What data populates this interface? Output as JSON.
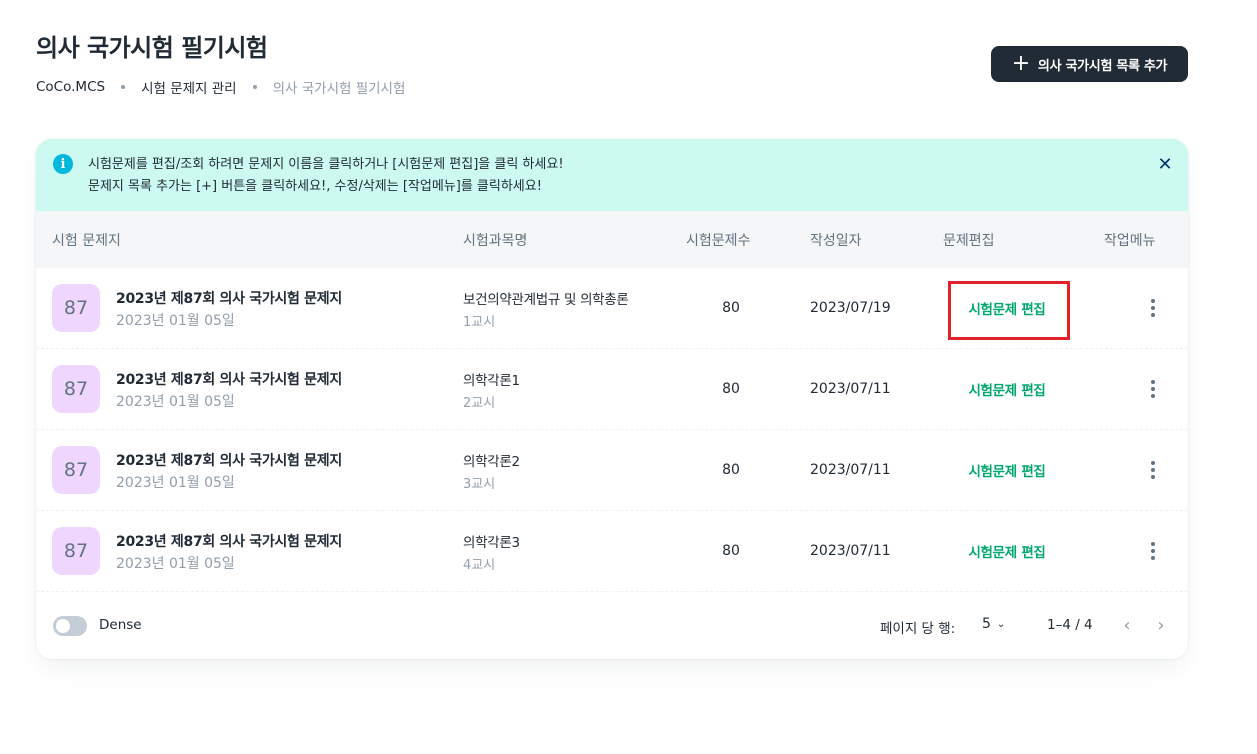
{
  "header": {
    "title": "의사 국가시험 필기시험",
    "breadcrumb": [
      "CoCo.MCS",
      "시험 문제지 관리",
      "의사 국가시험 필기시험"
    ],
    "add_button_label": "의사 국가시험 목록 추가"
  },
  "alert": {
    "line1": "시험문제를 편집/조회 하려면 문제지 이름을 클릭하거나 [시험문제 편집]을 클릭 하세요!",
    "line2": "문제지 목록 추가는 [+] 버튼을 클릭하세요!, 수정/삭제는 [작업메뉴]를 클릭하세요!",
    "icon": "info-icon",
    "close_icon": "close-icon"
  },
  "table": {
    "columns": [
      "시험 문제지",
      "시험과목명",
      "시험문제수",
      "작성일자",
      "문제편집",
      "작업메뉴"
    ],
    "rows": [
      {
        "badge": "87",
        "title": "2023년 제87회 의사 국가시험 문제지",
        "exam_date": "2023년 01월 05일",
        "subject": "보건의약관계법규 및 의학총론",
        "period": "1교시",
        "count": "80",
        "created": "2023/07/19",
        "edit_label": "시험문제 편집"
      },
      {
        "badge": "87",
        "title": "2023년 제87회 의사 국가시험 문제지",
        "exam_date": "2023년 01월 05일",
        "subject": "의학각론1",
        "period": "2교시",
        "count": "80",
        "created": "2023/07/11",
        "edit_label": "시험문제 편집"
      },
      {
        "badge": "87",
        "title": "2023년 제87회 의사 국가시험 문제지",
        "exam_date": "2023년 01월 05일",
        "subject": "의학각론2",
        "period": "3교시",
        "count": "80",
        "created": "2023/07/11",
        "edit_label": "시험문제 편집"
      },
      {
        "badge": "87",
        "title": "2023년 제87회 의사 국가시험 문제지",
        "exam_date": "2023년 01월 05일",
        "subject": "의학각론3",
        "period": "4교시",
        "count": "80",
        "created": "2023/07/11",
        "edit_label": "시험문제 편집"
      }
    ]
  },
  "footer": {
    "dense_label": "Dense",
    "dense_on": false,
    "rows_per_page_label": "페이지 당 행:",
    "rows_per_page_value": "5",
    "range_label": "1–4 / 4"
  },
  "colors": {
    "accent_green": "#00a76f",
    "alert_bg": "#ccfaf1",
    "badge_bg": "#efd6ff",
    "highlight_red": "#e3212b",
    "button_dark": "#212b36"
  }
}
